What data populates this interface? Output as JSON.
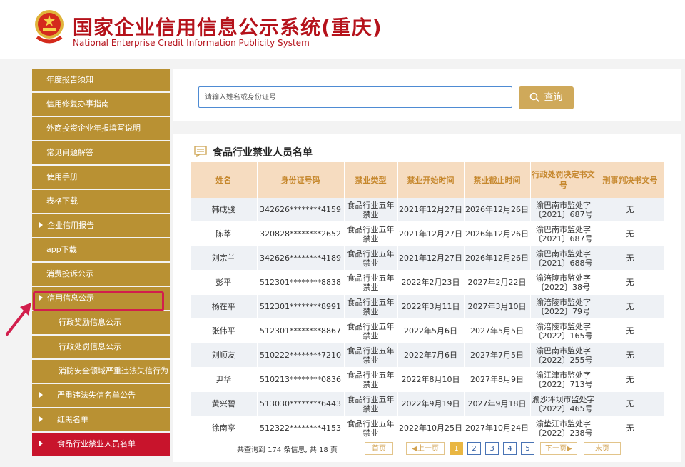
{
  "header": {
    "title": "国家企业信用信息公示系统",
    "city": "(重庆)",
    "subtitle": "National Enterprise Credit Information Publicity System"
  },
  "sidebar": {
    "items": [
      {
        "label": "年度报告须知"
      },
      {
        "label": "信用修复办事指南"
      },
      {
        "label": "外商投资企业年报填写说明"
      },
      {
        "label": "常见问题解答"
      },
      {
        "label": "使用手册"
      },
      {
        "label": "表格下载"
      },
      {
        "label": "企业信用报告"
      },
      {
        "label": "app下载"
      },
      {
        "label": "消费投诉公示"
      },
      {
        "label": "信用信息公示"
      },
      {
        "label": "行政奖励信息公示"
      },
      {
        "label": "行政处罚信息公示"
      },
      {
        "label": "消防安全领域严重违法失信行为"
      },
      {
        "label": "严重违法失信名单公告"
      },
      {
        "label": "红黑名单"
      },
      {
        "label": "食品行业禁业人员名单"
      }
    ]
  },
  "search": {
    "placeholder": "请输入姓名或身份证号",
    "button_label": "查询"
  },
  "list": {
    "title": "食品行业禁业人员名单",
    "columns": [
      "姓名",
      "身份证号码",
      "禁业类型",
      "禁业开始时间",
      "禁业截止时间",
      "行政处罚决定书文号",
      "刑事判决书文号"
    ],
    "rows": [
      [
        "韩成骏",
        "342626********4159",
        "食品行业五年禁业",
        "2021年12月27日",
        "2026年12月26日",
        "渝巴南市监处字〔2021〕687号",
        "无"
      ],
      [
        "陈莘",
        "320828********2652",
        "食品行业五年禁业",
        "2021年12月27日",
        "2026年12月26日",
        "渝巴南市监处字〔2021〕687号",
        "无"
      ],
      [
        "刘宗兰",
        "342626********4189",
        "食品行业五年禁业",
        "2021年12月27日",
        "2026年12月26日",
        "渝巴南市监处字〔2021〕688号",
        "无"
      ],
      [
        "彭平",
        "512301********8838",
        "食品行业五年禁业",
        "2022年2月23日",
        "2027年2月22日",
        "渝涪陵市监处字〔2022〕38号",
        "无"
      ],
      [
        "杨在平",
        "512301********8991",
        "食品行业五年禁业",
        "2022年3月11日",
        "2027年3月10日",
        "渝涪陵市监处字〔2022〕79号",
        "无"
      ],
      [
        "张伟平",
        "512301********8867",
        "食品行业五年禁业",
        "2022年5月6日",
        "2027年5月5日",
        "渝涪陵市监处字〔2022〕165号",
        "无"
      ],
      [
        "刘顺友",
        "510222********7210",
        "食品行业五年禁业",
        "2022年7月6日",
        "2027年7月5日",
        "渝巴南市监处字〔2022〕255号",
        "无"
      ],
      [
        "尹华",
        "510213********0836",
        "食品行业五年禁业",
        "2022年8月10日",
        "2027年8月9日",
        "渝江津市监处字〔2022〕713号",
        "无"
      ],
      [
        "黄兴碧",
        "513030********6443",
        "食品行业五年禁业",
        "2022年9月19日",
        "2027年9月18日",
        "渝沙坪坝市监处字〔2022〕465号",
        "无"
      ],
      [
        "徐南亭",
        "512322********4153",
        "食品行业五年禁业",
        "2022年10月25日",
        "2027年10月24日",
        "渝垫江市监处字〔2022〕238号",
        "无"
      ]
    ]
  },
  "pager": {
    "info": "共查询到  174  条信息, 共  18  页",
    "first": "首页",
    "prev": "◀上一页",
    "pages": [
      "1",
      "2",
      "3",
      "4",
      "5"
    ],
    "current": "1",
    "next": "下一页▶",
    "last": "末页"
  },
  "colors": {
    "sidebar": "#b99133",
    "sidebar_active": "#c8142c",
    "brand_red": "#b5121b",
    "header_row": "#f6dcc0",
    "search_button": "#cfa95a",
    "highlight": "#d21e4c"
  }
}
